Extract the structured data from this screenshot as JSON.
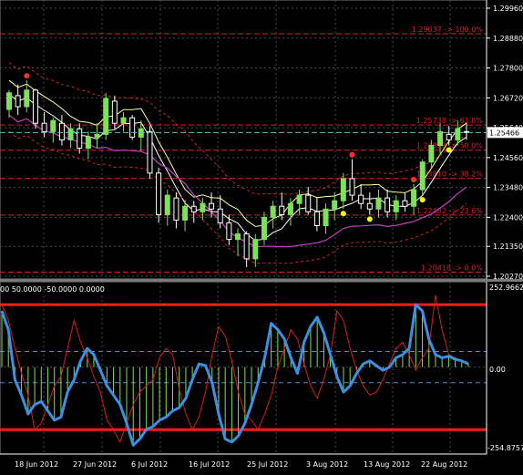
{
  "colors": {
    "background": "#000000",
    "grid": "#4a4a4a",
    "bull_candle": "#7fe05a",
    "bear_candle": "#ffffff",
    "envelope_yellow": "#ffff99",
    "ma_white": "#ffffff",
    "band_magenta": "#c040c0",
    "fib_red": "#d0222a",
    "osc_blue": "#3d8fe0",
    "osc_red": "#d02020",
    "level_red": "#ff1a1a",
    "current_price_dash": "#60c0c0",
    "histogram_green": "#7fe05a"
  },
  "main_chart": {
    "price_axis": [
      "1.29960",
      "1.28880",
      "1.27800",
      "1.26720",
      "1.25640",
      "1.24560",
      "1.23480",
      "1.22400",
      "1.21350",
      "1.20270"
    ],
    "current_price": "1.25466",
    "fib_levels": [
      {
        "label": "1.29037 -> 100.0%",
        "value": 1.29037
      },
      {
        "label": "1.25738 -> 61.8%",
        "value": 1.25738
      },
      {
        "label": "1.24828 -> 50.0%",
        "value": 1.24828
      },
      {
        "label": "1.23810 -> 38.2%",
        "value": 1.2381
      },
      {
        "label": "1.22482 -> 23.6%",
        "value": 1.22482
      },
      {
        "label": "1.20418 -> 0.0%",
        "value": 1.20418
      }
    ]
  },
  "indicator": {
    "header": "00 50.0000 -50.0000 0.0000",
    "axis": [
      "252.9662",
      "0.00",
      "-254.8757"
    ],
    "upper_level": 200,
    "lower_level": -200,
    "mid_upper": 50,
    "mid_lower": -50,
    "range": [
      -254.8757,
      252.9662
    ]
  },
  "date_axis": [
    "18 Jun 2012",
    "27 Jun 2012",
    "6 Jul 2012",
    "16 Jul 2012",
    "25 Jul 2012",
    "3 Aug 2012",
    "13 Aug 2012",
    "22 Aug 2012"
  ],
  "chart_data": {
    "type": "candlestick",
    "ylim": [
      1.2027,
      1.2996
    ],
    "candles": [
      [
        1.263,
        1.27,
        1.26,
        1.269
      ],
      [
        1.268,
        1.272,
        1.261,
        1.264
      ],
      [
        1.264,
        1.2735,
        1.262,
        1.27
      ],
      [
        1.27,
        1.2705,
        1.256,
        1.258
      ],
      [
        1.258,
        1.262,
        1.253,
        1.255
      ],
      [
        1.255,
        1.26,
        1.251,
        1.259
      ],
      [
        1.258,
        1.261,
        1.25,
        1.252
      ],
      [
        1.252,
        1.258,
        1.249,
        1.256
      ],
      [
        1.256,
        1.258,
        1.247,
        1.249
      ],
      [
        1.249,
        1.255,
        1.245,
        1.253
      ],
      [
        1.253,
        1.258,
        1.249,
        1.254
      ],
      [
        1.254,
        1.269,
        1.252,
        1.267
      ],
      [
        1.266,
        1.268,
        1.256,
        1.258
      ],
      [
        1.258,
        1.262,
        1.255,
        1.26
      ],
      [
        1.26,
        1.261,
        1.252,
        1.253
      ],
      [
        1.253,
        1.259,
        1.248,
        1.256
      ],
      [
        1.255,
        1.257,
        1.238,
        1.24
      ],
      [
        1.24,
        1.242,
        1.222,
        1.225
      ],
      [
        1.225,
        1.234,
        1.221,
        1.232
      ],
      [
        1.231,
        1.233,
        1.22,
        1.223
      ],
      [
        1.223,
        1.23,
        1.219,
        1.228
      ],
      [
        1.228,
        1.23,
        1.222,
        1.226
      ],
      [
        1.226,
        1.231,
        1.223,
        1.229
      ],
      [
        1.229,
        1.233,
        1.224,
        1.227
      ],
      [
        1.227,
        1.232,
        1.22,
        1.222
      ],
      [
        1.222,
        1.225,
        1.214,
        1.216
      ],
      [
        1.216,
        1.22,
        1.21,
        1.218
      ],
      [
        1.218,
        1.219,
        1.206,
        1.209
      ],
      [
        1.209,
        1.218,
        1.206,
        1.216
      ],
      [
        1.216,
        1.226,
        1.214,
        1.224
      ],
      [
        1.224,
        1.23,
        1.22,
        1.228
      ],
      [
        1.228,
        1.233,
        1.223,
        1.225
      ],
      [
        1.225,
        1.231,
        1.221,
        1.229
      ],
      [
        1.229,
        1.234,
        1.225,
        1.232
      ],
      [
        1.232,
        1.235,
        1.225,
        1.226
      ],
      [
        1.226,
        1.231,
        1.219,
        1.221
      ],
      [
        1.221,
        1.229,
        1.218,
        1.227
      ],
      [
        1.227,
        1.233,
        1.223,
        1.23
      ],
      [
        1.23,
        1.24,
        1.227,
        1.238
      ],
      [
        1.238,
        1.245,
        1.23,
        1.232
      ],
      [
        1.232,
        1.236,
        1.227,
        1.229
      ],
      [
        1.229,
        1.233,
        1.225,
        1.227
      ],
      [
        1.227,
        1.234,
        1.224,
        1.231
      ],
      [
        1.231,
        1.234,
        1.224,
        1.226
      ],
      [
        1.226,
        1.232,
        1.223,
        1.23
      ],
      [
        1.23,
        1.233,
        1.226,
        1.228
      ],
      [
        1.228,
        1.236,
        1.225,
        1.234
      ],
      [
        1.234,
        1.245,
        1.232,
        1.244
      ],
      [
        1.244,
        1.252,
        1.242,
        1.25
      ],
      [
        1.25,
        1.258,
        1.247,
        1.255
      ],
      [
        1.254,
        1.257,
        1.25,
        1.252
      ],
      [
        1.252,
        1.259,
        1.25,
        1.256
      ],
      [
        1.255,
        1.258,
        1.252,
        1.2547
      ]
    ],
    "osc_blue": [
      180,
      120,
      -40,
      -90,
      -150,
      -120,
      -110,
      -140,
      -170,
      -160,
      -80,
      -40,
      20,
      60,
      40,
      -10,
      -60,
      -90,
      -120,
      -180,
      -250,
      -230,
      -200,
      -190,
      -170,
      -160,
      -140,
      -130,
      -100,
      -40,
      10,
      5,
      -50,
      -150,
      -230,
      -240,
      -220,
      -180,
      -120,
      -50,
      30,
      140,
      120,
      90,
      30,
      -20,
      80,
      130,
      160,
      110,
      40,
      -30,
      -80,
      -60,
      -20,
      10,
      20,
      5,
      -10,
      0,
      30,
      40,
      60,
      200,
      180,
      90,
      40,
      30,
      35,
      25,
      20,
      10
    ],
    "osc_red": [
      200,
      150,
      60,
      -20,
      -90,
      -200,
      -180,
      -120,
      -60,
      -30,
      60,
      150,
      80,
      30,
      -30,
      -80,
      -170,
      -200,
      -240,
      -180,
      -120,
      -80,
      -60,
      -40,
      30,
      60,
      40,
      -70,
      -150,
      -200,
      -160,
      -80,
      40,
      130,
      100,
      20,
      -80,
      -150,
      -170,
      -200,
      -150,
      -90,
      0,
      60,
      120,
      90,
      10,
      -60,
      -100,
      -40,
      40,
      180,
      150,
      60,
      -10,
      -60,
      -90,
      -80,
      -40,
      10,
      60,
      80,
      40,
      -10,
      30,
      60,
      230,
      120,
      40,
      30,
      20,
      15
    ]
  }
}
